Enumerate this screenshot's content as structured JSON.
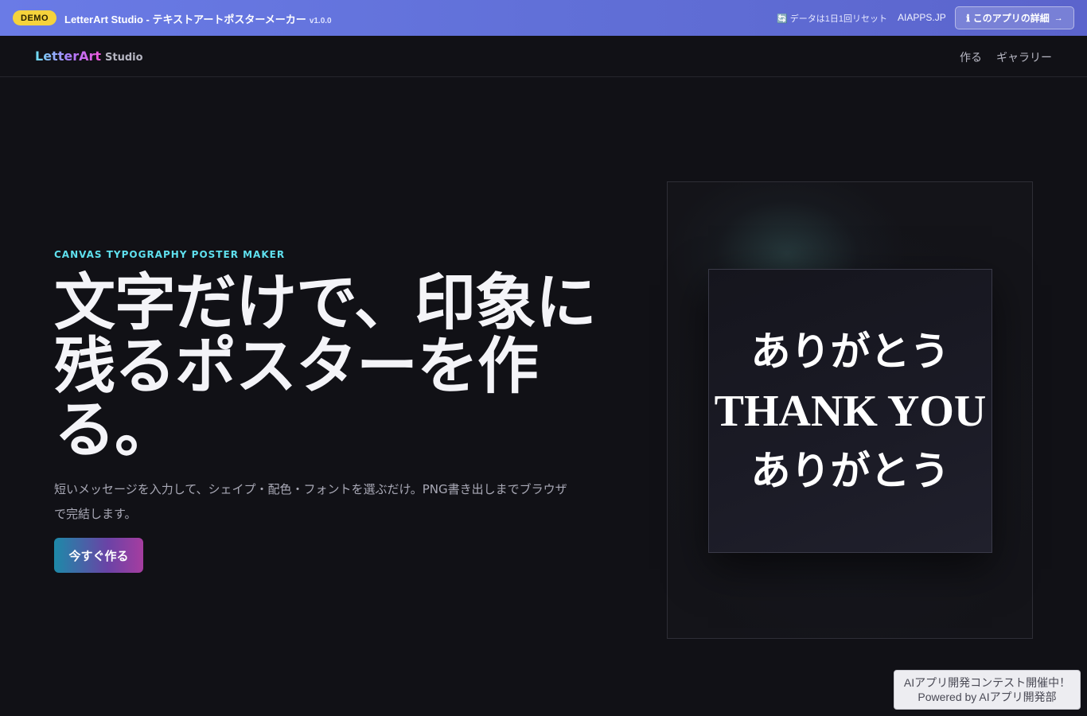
{
  "banner": {
    "badge": "DEMO",
    "title": "LetterArt Studio - テキストアートポスターメーカー",
    "version": "v1.0.0",
    "reset_icon": "🔄",
    "reset_note": "データは1日1回リセット",
    "site_link": "AIAPPS.JP",
    "details_icon": "ℹ",
    "details_label": "このアプリの詳細",
    "details_arrow": "→"
  },
  "nav": {
    "logo_main": "LetterArt",
    "logo_sub": "Studio",
    "links": [
      "作る",
      "ギャラリー"
    ]
  },
  "hero": {
    "eyebrow": "CANVAS TYPOGRAPHY POSTER MAKER",
    "headline": "文字だけで、印象に残るポスターを作る。",
    "lede": "短いメッセージを入力して、シェイプ・配色・フォントを選ぶだけ。PNG書き出しまでブラウザで完結します。",
    "cta_label": "今すぐ作る"
  },
  "preview": {
    "lines": [
      "ありがとう",
      "THANK YOU",
      "ありがとう"
    ]
  },
  "contest": {
    "line1": "AIアプリ開発コンテスト開催中！",
    "line2": "Powered by AIアプリ開発部"
  },
  "colors": {
    "accent_cyan": "#5fe0ee",
    "badge_yellow": "#f5d33c",
    "banner_blue": "#6170d8",
    "background": "#111116"
  }
}
